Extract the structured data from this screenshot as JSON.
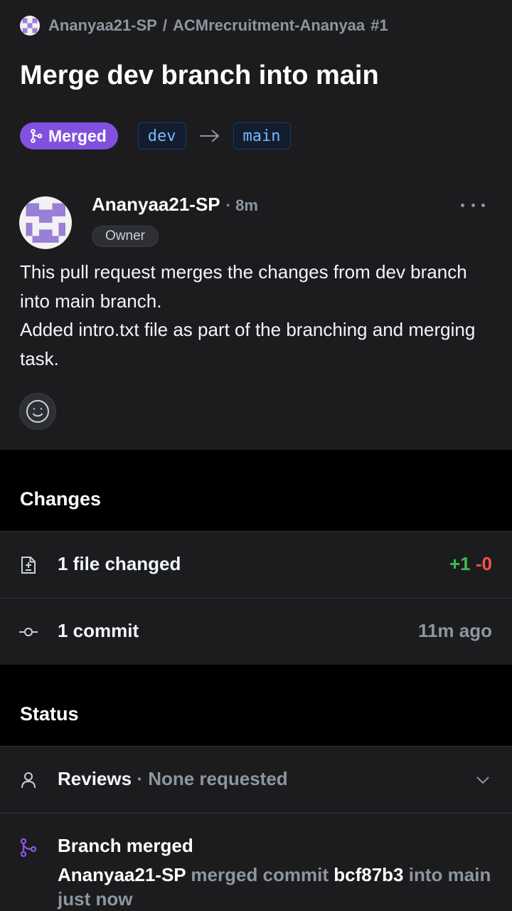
{
  "header": {
    "repo_owner": "Ananyaa21-SP",
    "separator": "/",
    "repo_name": "ACMrecruitment-Ananyaa",
    "pr_number": "#1",
    "title": "Merge dev branch into main"
  },
  "branches": {
    "state_label": "Merged",
    "head": "dev",
    "base": "main"
  },
  "comment": {
    "author": "Ananyaa21-SP",
    "time": "· 8m",
    "role_badge": "Owner",
    "body_line1": "This pull request merges the changes from dev branch into main branch.",
    "body_line2": "Added intro.txt file as part of the branching and merging task."
  },
  "changes": {
    "heading": "Changes",
    "files_label": "1 file changed",
    "additions": "+1",
    "deletions": "-0",
    "commits_label": "1 commit",
    "commits_time": "11m ago"
  },
  "status": {
    "heading": "Status",
    "reviews_label": "Reviews",
    "reviews_value": "· None requested",
    "merged_title": "Branch merged",
    "merged_user": "Ananyaa21-SP",
    "merged_text": "merged commit",
    "merged_sha": "bcf87b3",
    "merged_into": "into",
    "merged_branch": "main just now"
  },
  "colors": {
    "merged_purple": "#8250df",
    "additions_green": "#3fb950",
    "deletions_red": "#f85149",
    "background": "#1c1c1f"
  }
}
